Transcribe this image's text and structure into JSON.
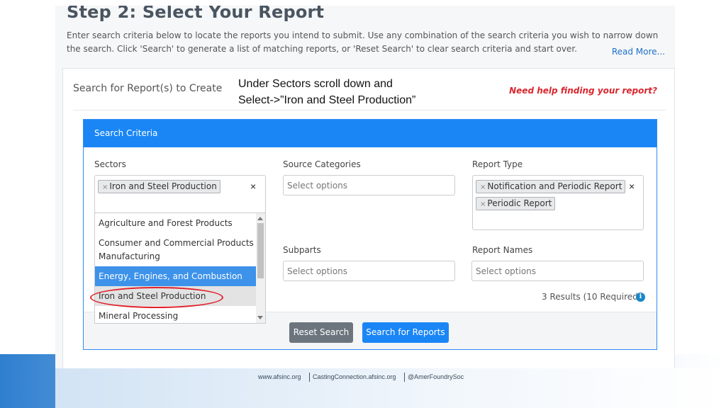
{
  "page": {
    "step_title": "Step 2: Select Your Report",
    "intro_text": "Enter search criteria below to locate the reports you intend to submit. Use any combination of the search criteria you wish to narrow down the search. Click 'Search' to generate a list of matching reports, or 'Reset Search' to clear search criteria and start over.",
    "read_more": "Read More..."
  },
  "card": {
    "title": "Search for Report(s) to Create",
    "help_link": "Need help finding your report?"
  },
  "annotation": {
    "line1": "Under Sectors scroll down and",
    "line2": "Select->”Iron and Steel Production”"
  },
  "search_criteria": {
    "header": "Search Criteria",
    "sectors": {
      "label": "Sectors",
      "selected": [
        "Iron and Steel Production"
      ],
      "options": [
        "Agriculture and Forest Products",
        "Consumer and Commercial Products",
        "Manufacturing",
        "Energy, Engines, and Combustion",
        "Iron and Steel Production",
        "Mineral Processing"
      ],
      "highlighted_option": "Energy, Engines, and Combustion"
    },
    "source_categories": {
      "label": "Source Categories",
      "placeholder": "Select options"
    },
    "report_type": {
      "label": "Report Type",
      "selected": [
        "Notification and Periodic Report",
        "Periodic Report"
      ]
    },
    "subparts": {
      "label": "Subparts",
      "placeholder": "Select options"
    },
    "report_names": {
      "label": "Report Names",
      "placeholder": "Select options"
    },
    "results": "3 Results (10 Required)",
    "reset_button": "Reset Search",
    "search_button": "Search for Reports"
  },
  "chip_remove_glyph": "×",
  "clear_glyph": "×",
  "footer": {
    "site": "www.afsinc.org",
    "casting": "CastingConnection.afsinc.org",
    "social": "@AmerFoundrySoc"
  },
  "colors": {
    "primary": "#1a86f5",
    "secondary_button": "#6c757d",
    "help_link": "#d9262e",
    "annotation_oval": "#e0202a"
  }
}
